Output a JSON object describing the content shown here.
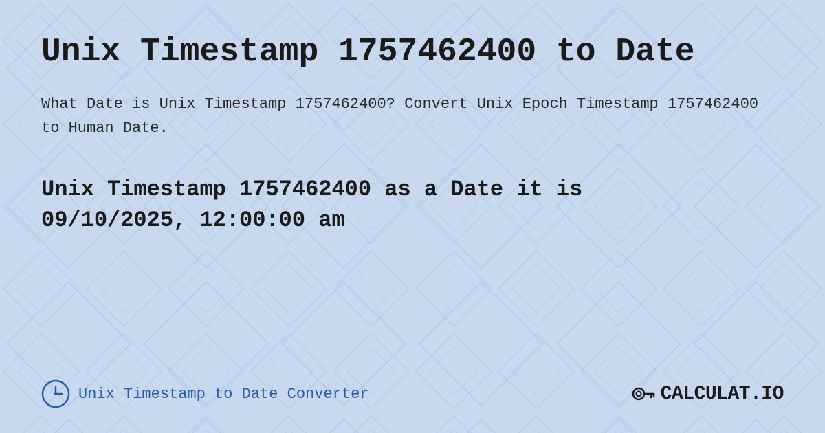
{
  "page": {
    "title": "Unix Timestamp 1757462400 to Date",
    "description": "What Date is Unix Timestamp 1757462400? Convert Unix Epoch Timestamp 1757462400 to Human Date.",
    "result_line1": "Unix Timestamp 1757462400 as a Date it is",
    "result_line2": "09/10/2025, 12:00:00 am",
    "footer": {
      "label": "Unix Timestamp to Date Converter",
      "logo_text": "CALCULAT.IO"
    },
    "background_color": "#c5d5ea",
    "accent_color": "#2a5ca8"
  }
}
